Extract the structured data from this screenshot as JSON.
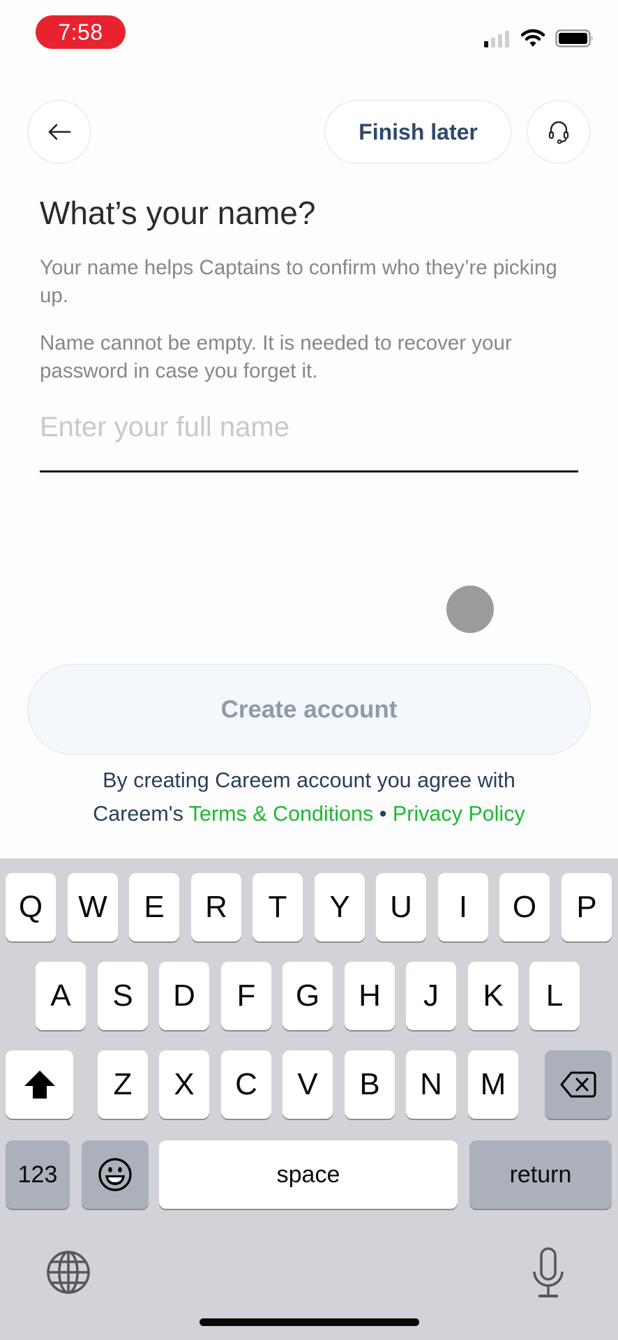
{
  "status_bar": {
    "time": "7:58",
    "signal_icon": "cellular-signal-icon",
    "wifi_icon": "wifi-icon",
    "battery_icon": "battery-icon",
    "time_pill_color": "#e8232f"
  },
  "header": {
    "back_icon": "arrow-left-icon",
    "finish_later_label": "Finish later",
    "support_icon": "headset-icon"
  },
  "main": {
    "title": "What’s your name?",
    "description": "Your name helps Captains to confirm who they’re picking up.",
    "warning": "Name cannot be empty. It is needed to recover your password in case you forget it.",
    "name_input": {
      "value": "",
      "placeholder": "Enter your full name"
    }
  },
  "footer": {
    "create_account_label": "Create account",
    "terms_line1": "By creating Careem account you agree with",
    "terms_prefix": "Careem's",
    "terms_link": "Terms & Conditions",
    "separator": "•",
    "privacy_link": "Privacy Policy",
    "link_color": "#1fb832"
  },
  "keyboard": {
    "row1": [
      "Q",
      "W",
      "E",
      "R",
      "T",
      "Y",
      "U",
      "I",
      "O",
      "P"
    ],
    "row2": [
      "A",
      "S",
      "D",
      "F",
      "G",
      "H",
      "J",
      "K",
      "L"
    ],
    "row3": [
      "Z",
      "X",
      "C",
      "V",
      "B",
      "N",
      "M"
    ],
    "shift_icon": "shift-icon",
    "delete_icon": "backspace-icon",
    "numbers_label": "123",
    "emoji_icon": "emoji-icon",
    "space_label": "space",
    "return_label": "return",
    "globe_icon": "globe-icon",
    "mic_icon": "microphone-icon"
  }
}
